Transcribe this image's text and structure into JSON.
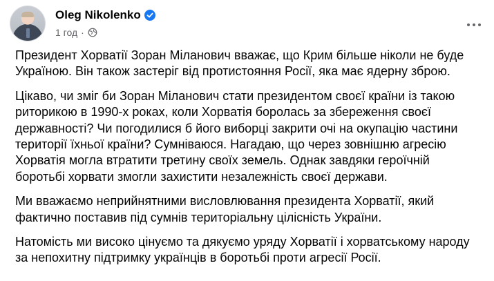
{
  "post": {
    "author": "Oleg Nikolenko",
    "time": "1 год",
    "separator": "·",
    "icons": {
      "verified": "verified-badge-icon",
      "audience": "globe-icon",
      "more": "more-options-icon"
    },
    "accent_color": "#1877f2",
    "paragraphs": [
      {
        "lines": [
          "Президент Хорватії Зоран Міланович вважає, що Крим більше ніколи не буде",
          "Україною. Він також застеріг від протистояння Росії, яка має ядерну зброю."
        ]
      },
      {
        "lines": [
          "Цікаво, чи зміг би Зоран Міланович стати президентом своєї країни із такою",
          "риторикою в 1990-х роках, коли Хорватія боролась за збереження своєї",
          "державності? Чи погодилися б його виборці закрити очі на окупацію частини",
          "території їхньої країни? Сумніваюся. Нагадаю, що через зовнішню агресію",
          "Хорватія могла втратити третину своїх земель. Однак завдяки героїчній",
          "боротьбі хорвати змогли захистити незалежність своєї держави."
        ]
      },
      {
        "lines": [
          "Ми вважаємо неприйнятними висловлювання президента Хорватії, який",
          "фактично поставив під сумнів територіальну цілісність України."
        ]
      },
      {
        "lines": [
          "Натомість ми високо цінуємо та дякуємо уряду Хорватії і хорватському народу",
          "за непохитну підтримку українців в боротьбі проти агресії Росії."
        ]
      }
    ]
  }
}
